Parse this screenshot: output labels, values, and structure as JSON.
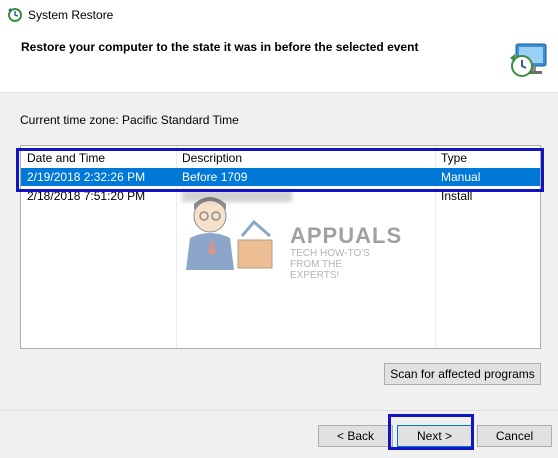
{
  "window": {
    "title": "System Restore"
  },
  "header": {
    "title": "Restore your computer to the state it was in before the selected event"
  },
  "timezone_label": "Current time zone: Pacific Standard Time",
  "table": {
    "columns": [
      "Date and Time",
      "Description",
      "Type"
    ],
    "rows": [
      {
        "date": "2/19/2018 2:32:26 PM",
        "description": "Before 1709",
        "type": "Manual",
        "selected": true
      },
      {
        "date": "2/18/2018 7:51:20 PM",
        "description": "",
        "type": "Install",
        "selected": false
      }
    ]
  },
  "buttons": {
    "scan": "Scan for affected programs",
    "back": "< Back",
    "next": "Next >",
    "cancel": "Cancel"
  },
  "watermark": {
    "brand": "APPUALS",
    "tagline": "TECH HOW-TO'S FROM THE EXPERTS!"
  },
  "colors": {
    "selection": "#0078d7",
    "highlight_box": "#1014c4",
    "dialog_bg": "#f0f0f0"
  }
}
